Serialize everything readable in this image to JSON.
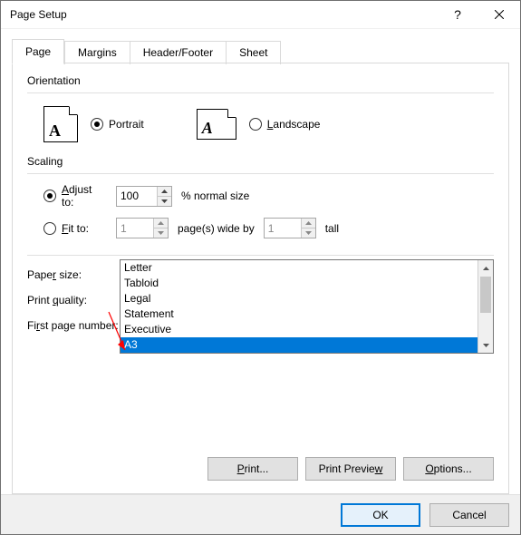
{
  "window": {
    "title": "Page Setup"
  },
  "tabs": {
    "page": "Page",
    "margins": "Margins",
    "headerfooter": "Header/Footer",
    "sheet": "Sheet"
  },
  "orientation": {
    "label": "Orientation",
    "portrait_prefix": "P",
    "portrait_suffix": "ortrait",
    "landscape_prefix": "L",
    "landscape_suffix": "andscape",
    "glyph": "A"
  },
  "scaling": {
    "label": "Scaling",
    "adjust_prefix": "A",
    "adjust_suffix": "djust to:",
    "adjust_value": "100",
    "normal_size": "% normal size",
    "fit_prefix": "F",
    "fit_suffix": "it to:",
    "fit_wide": "1",
    "fit_tall": "1",
    "pages_wide": "page(s) wide by",
    "tall": "tall"
  },
  "paper": {
    "size_label_pre": "Pape",
    "size_label_u": "r",
    "size_label_post": " size:",
    "selected": "Letter",
    "options": {
      "0": "Letter",
      "1": "Tabloid",
      "2": "Legal",
      "3": "Statement",
      "4": "Executive",
      "5": "A3"
    }
  },
  "print_quality": {
    "label_pre": "Print ",
    "label_u": "q",
    "label_post": "uality:"
  },
  "first_page": {
    "label_pre": "Fi",
    "label_u": "r",
    "label_post": "st page number:"
  },
  "actions": {
    "print_u": "P",
    "print_post": "rint...",
    "preview_pre": "Print Previe",
    "preview_u": "w",
    "options_u": "O",
    "options_post": "ptions..."
  },
  "footer": {
    "ok": "OK",
    "cancel": "Cancel"
  }
}
